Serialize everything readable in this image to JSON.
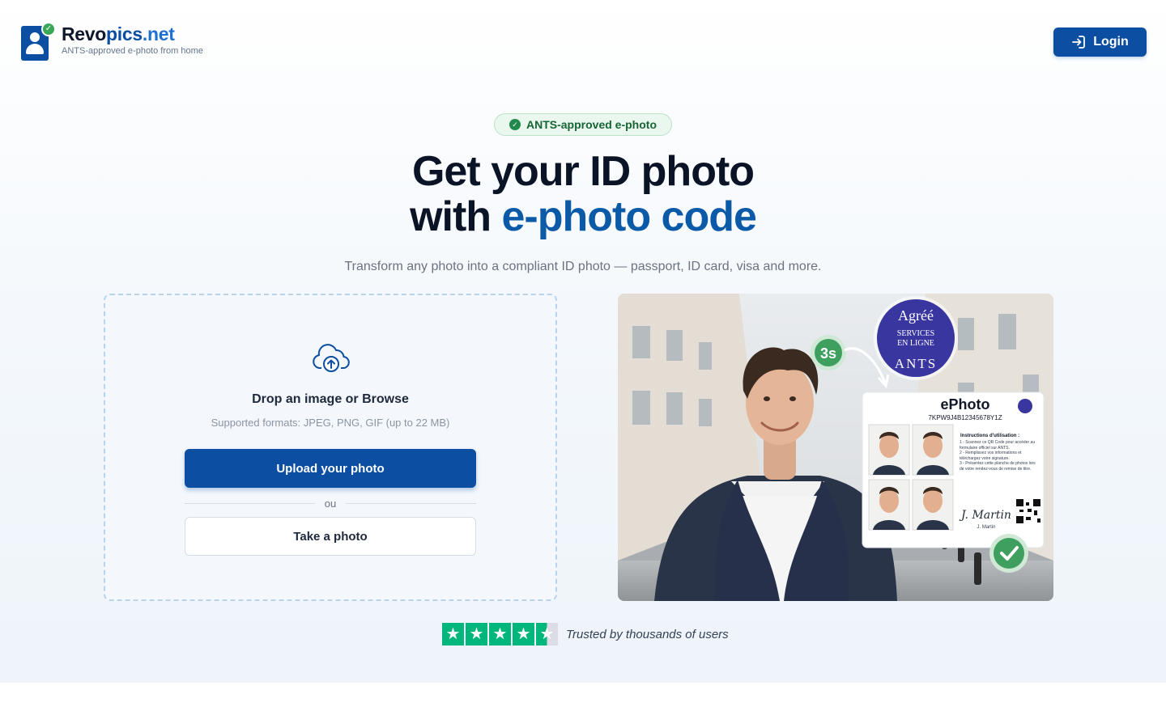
{
  "brand": {
    "name_part1": "Revo",
    "name_part2": "pics",
    "name_part3": ".net",
    "tagline": "ANTS-approved e-photo from home"
  },
  "header": {
    "login_label": "Login"
  },
  "hero": {
    "badge": "ANTS-approved e-photo",
    "title_line1": "Get your ID photo",
    "title_line2_plain": "with ",
    "title_line2_accent": "e-photo code",
    "subtitle": "Transform any photo into a compliant ID photo — passport, ID card, visa and more."
  },
  "upload": {
    "drop_text": "Drop an image or Browse",
    "formats": "Supported formats: JPEG, PNG, GIF (up to 22 MB)",
    "upload_label": "Upload your photo",
    "or_label": "ou",
    "take_label": "Take a photo"
  },
  "preview": {
    "timer": "3s",
    "seal_top": "Agréé",
    "seal_mid1": "SERVICES",
    "seal_mid2": "EN LIGNE",
    "seal_bottom": "ANTS",
    "card_title": "ePhoto",
    "card_code": "7KPW9J4B12345678Y1Z",
    "instructions_title": "Instructions d'utilisation :",
    "instruction_1": "1 - Scannez ce QR Code pour accéder au formulaire officiel sur ANTS.",
    "instruction_2": "2 - Remplissez vos informations et téléchargez votre signature.",
    "instruction_3": "3 - Présentez cette planche de photos lors de votre rendez-vous de remise de titre.",
    "signature": "J. Martin",
    "signature_name": "J. Martin"
  },
  "trust": {
    "rating": 4.5,
    "max_rating": 5,
    "text": "Trusted by thousands of users"
  },
  "colors": {
    "primary": "#0b4ea2",
    "accent_text": "#0b5aa8",
    "success": "#1f8a4c",
    "trustpilot": "#00b67a"
  },
  "icons": {
    "logo": "id-card-person-icon",
    "login": "sign-in-icon",
    "badge": "check-circle-icon",
    "upload": "cloud-upload-icon",
    "star": "star-icon"
  }
}
